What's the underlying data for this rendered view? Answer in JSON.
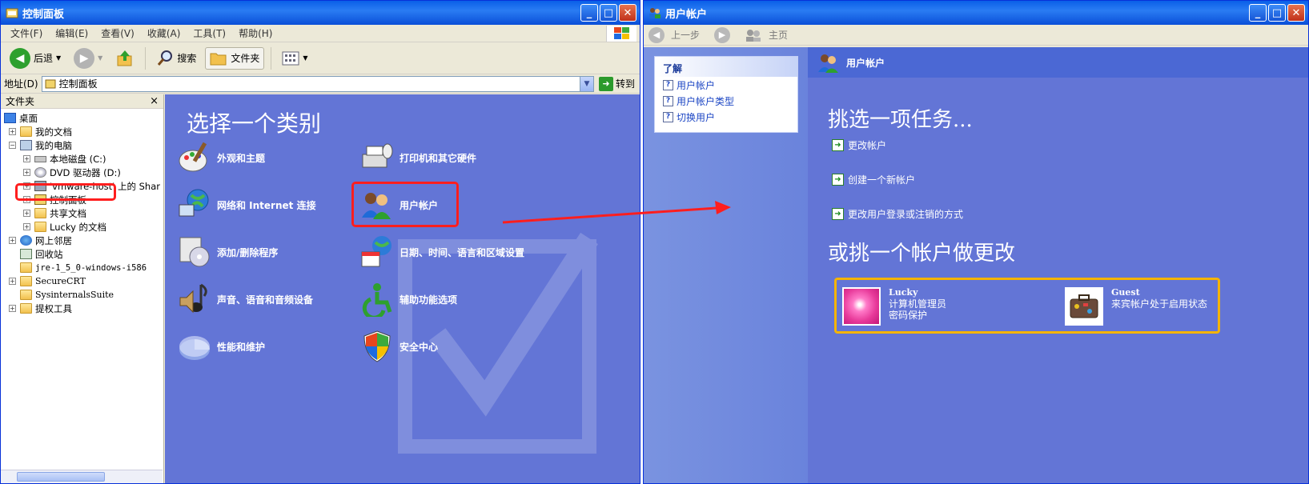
{
  "left_window": {
    "title": "控制面板",
    "menu": [
      "文件(F)",
      "编辑(E)",
      "查看(V)",
      "收藏(A)",
      "工具(T)",
      "帮助(H)"
    ],
    "toolbar": {
      "back": "后退",
      "search": "搜索",
      "folders": "文件夹"
    },
    "address": {
      "label": "地址(D)",
      "value": "控制面板",
      "go": "转到"
    },
    "tree": {
      "header": "文件夹",
      "close_glyph": "×",
      "items": [
        "桌面",
        "我的文档",
        "我的电脑",
        "本地磁盘 (C:)",
        "DVD 驱动器 (D:)",
        "'vmware-host' 上的 Shar",
        "控制面板",
        "共享文档",
        "Lucky 的文档",
        "网上邻居",
        "回收站",
        "jre-1_5_0-windows-i586",
        "SecureCRT",
        "SysinternalsSuite",
        "提权工具"
      ]
    },
    "category_title": "选择一个类别",
    "categories": [
      "外观和主题",
      "打印机和其它硬件",
      "网络和 Internet 连接",
      "用户帐户",
      "添加/删除程序",
      "日期、时间、语言和区域设置",
      "声音、语音和音频设备",
      "辅助功能选项",
      "性能和维护",
      "安全中心"
    ]
  },
  "right_window": {
    "title": "用户帐户",
    "nav": {
      "back": "上一步",
      "home": "主页"
    },
    "learn": {
      "header": "了解",
      "items": [
        "用户帐户",
        "用户帐户类型",
        "切换用户"
      ]
    },
    "header": "用户帐户",
    "task_title": "挑选一项任务...",
    "tasks": [
      "更改帐户",
      "创建一个新帐户",
      "更改用户登录或注销的方式"
    ],
    "account_title": "或挑一个帐户做更改",
    "accounts": [
      {
        "name": "Lucky",
        "line1": "计算机管理员",
        "line2": "密码保护"
      },
      {
        "name": "Guest",
        "line1": "来宾帐户处于启用状态",
        "line2": ""
      }
    ]
  },
  "colors": {
    "title_blue": "#0a5fe8",
    "pane_blue": "#6375d6",
    "highlight_red": "#ff1e1e",
    "highlight_orange": "#f5b400"
  }
}
